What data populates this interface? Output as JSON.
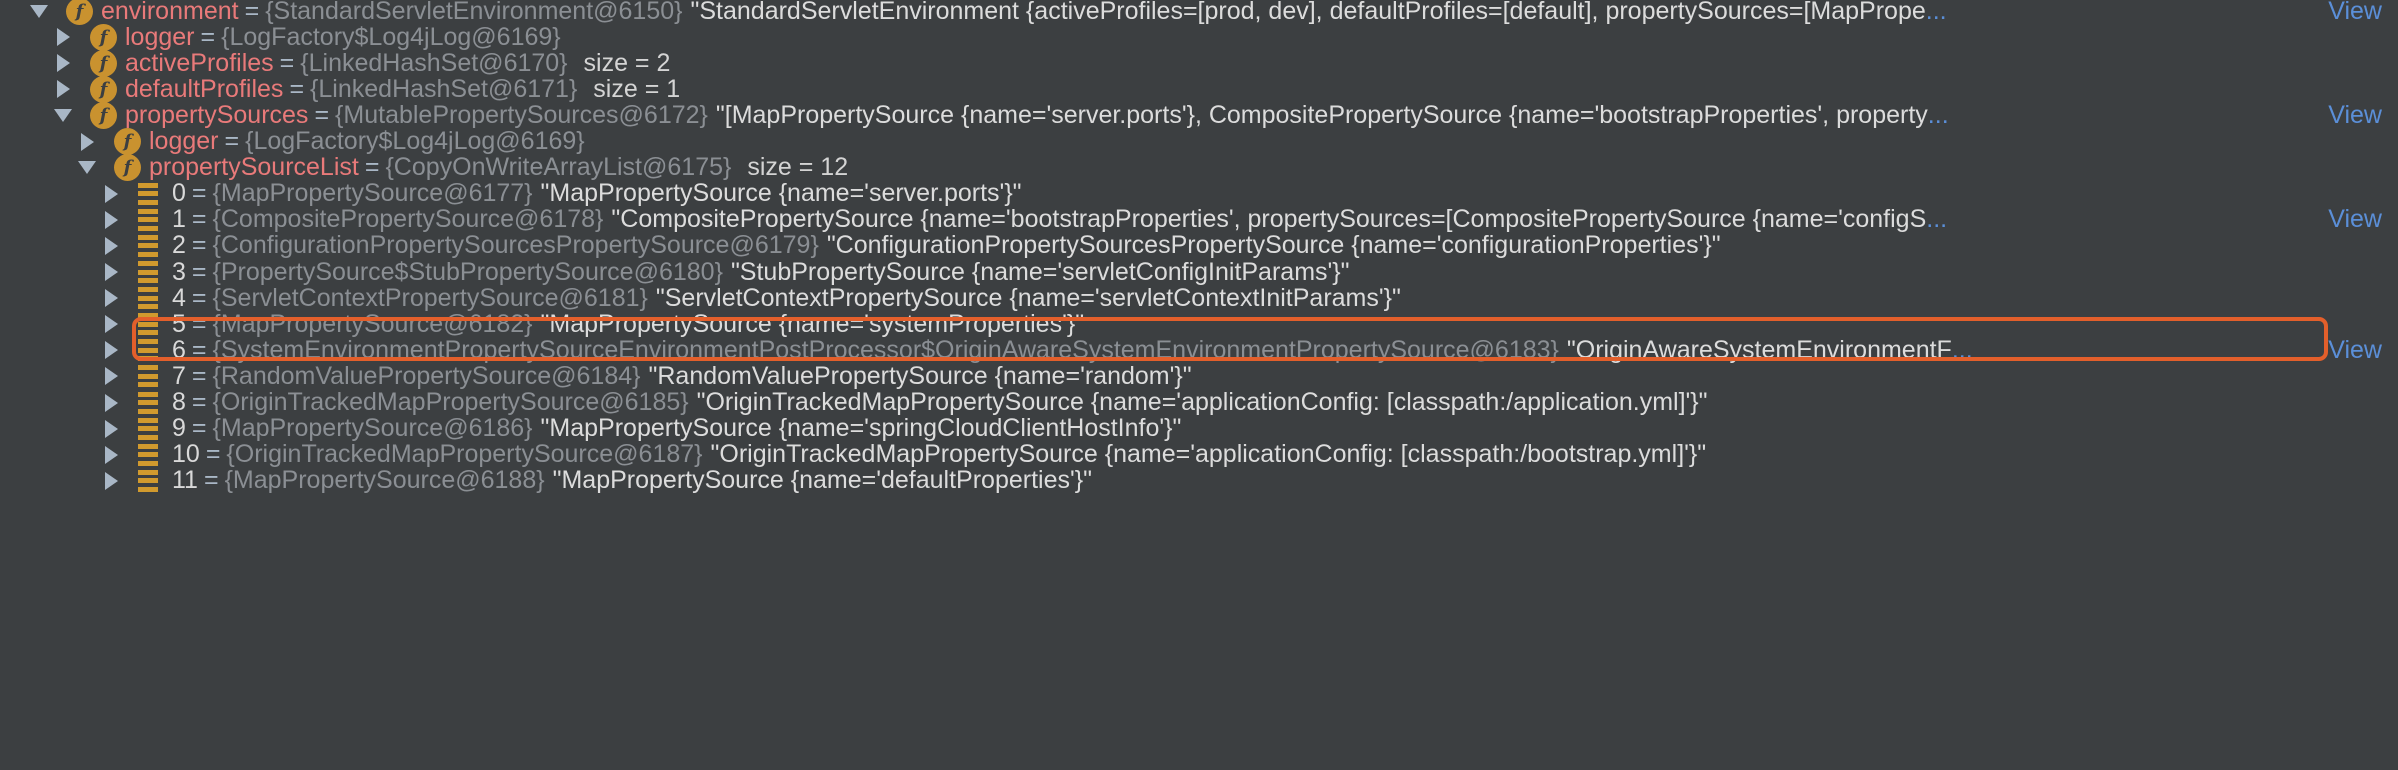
{
  "rows": [
    {
      "indent": 0,
      "expanded": true,
      "kind": "field",
      "name": "environment",
      "type": "{StandardServletEnvironment@6150}",
      "value": "\"StandardServletEnvironment {activeProfiles=[prod, dev], defaultProfiles=[default], propertySources=[MapPrope",
      "ellipsis": "...",
      "view": "View"
    },
    {
      "indent": 1,
      "expanded": false,
      "kind": "field",
      "name": "logger",
      "type": "{LogFactory$Log4jLog@6169}"
    },
    {
      "indent": 1,
      "expanded": false,
      "kind": "field",
      "name": "activeProfiles",
      "type": "{LinkedHashSet@6170}",
      "size": "size = 2"
    },
    {
      "indent": 1,
      "expanded": false,
      "kind": "field",
      "name": "defaultProfiles",
      "type": "{LinkedHashSet@6171}",
      "size": "size = 1"
    },
    {
      "indent": 1,
      "expanded": true,
      "kind": "field",
      "name": "propertySources",
      "type": "{MutablePropertySources@6172}",
      "value": "\"[MapPropertySource {name='server.ports'}, CompositePropertySource {name='bootstrapProperties', property",
      "ellipsis": "...",
      "view": "View"
    },
    {
      "indent": 2,
      "expanded": false,
      "kind": "field",
      "name": "logger",
      "type": "{LogFactory$Log4jLog@6169}"
    },
    {
      "indent": 2,
      "expanded": true,
      "kind": "field",
      "name": "propertySourceList",
      "type": "{CopyOnWriteArrayList@6175}",
      "size": "size = 12"
    },
    {
      "indent": 3,
      "expanded": false,
      "kind": "elem",
      "name": "0",
      "type": "{MapPropertySource@6177}",
      "value": "\"MapPropertySource {name='server.ports'}\""
    },
    {
      "indent": 3,
      "expanded": false,
      "kind": "elem",
      "name": "1",
      "type": "{CompositePropertySource@6178}",
      "value": "\"CompositePropertySource {name='bootstrapProperties', propertySources=[CompositePropertySource {name='configS",
      "ellipsis": "...",
      "view": "View"
    },
    {
      "indent": 3,
      "expanded": false,
      "kind": "elem",
      "name": "2",
      "type": "{ConfigurationPropertySourcesPropertySource@6179}",
      "value": "\"ConfigurationPropertySourcesPropertySource {name='configurationProperties'}\""
    },
    {
      "indent": 3,
      "expanded": false,
      "kind": "elem",
      "name": "3",
      "type": "{PropertySource$StubPropertySource@6180}",
      "value": "\"StubPropertySource {name='servletConfigInitParams'}\""
    },
    {
      "indent": 3,
      "expanded": false,
      "kind": "elem",
      "name": "4",
      "type": "{ServletContextPropertySource@6181}",
      "value": "\"ServletContextPropertySource {name='servletContextInitParams'}\""
    },
    {
      "indent": 3,
      "expanded": false,
      "kind": "elem",
      "name": "5",
      "type": "{MapPropertySource@6182}",
      "value": "\"MapPropertySource {name='systemProperties'}\""
    },
    {
      "indent": 3,
      "expanded": false,
      "kind": "elem",
      "name": "6",
      "type": "{SystemEnvironmentPropertySourceEnvironmentPostProcessor$OriginAwareSystemEnvironmentPropertySource@6183}",
      "value": "\"OriginAwareSystemEnvironmentF",
      "ellipsis": "...",
      "view": "View"
    },
    {
      "indent": 3,
      "expanded": false,
      "kind": "elem",
      "name": "7",
      "type": "{RandomValuePropertySource@6184}",
      "value": "\"RandomValuePropertySource {name='random'}\""
    },
    {
      "indent": 3,
      "expanded": false,
      "kind": "elem",
      "name": "8",
      "type": "{OriginTrackedMapPropertySource@6185}",
      "value": "\"OriginTrackedMapPropertySource {name='applicationConfig: [classpath:/application.yml]'}\""
    },
    {
      "indent": 3,
      "expanded": false,
      "kind": "elem",
      "name": "9",
      "type": "{MapPropertySource@6186}",
      "value": "\"MapPropertySource {name='springCloudClientHostInfo'}\""
    },
    {
      "indent": 3,
      "expanded": false,
      "kind": "elem",
      "name": "10",
      "type": "{OriginTrackedMapPropertySource@6187}",
      "value": "\"OriginTrackedMapPropertySource {name='applicationConfig: [classpath:/bootstrap.yml]'}\""
    },
    {
      "indent": 3,
      "expanded": false,
      "kind": "elem",
      "name": "11",
      "type": "{MapPropertySource@6188}",
      "value": "\"MapPropertySource {name='defaultProperties'}\""
    }
  ],
  "highlighted_row": "1",
  "colors": {
    "background": "#3c3f41",
    "field_name": "#e97a7a",
    "type": "#8b8f94",
    "link": "#5b8fd8",
    "highlight": "#e35f2b",
    "icon": "#c9922f"
  },
  "icons": {
    "field": "field-f-icon",
    "element": "array-element-icon",
    "expanded": "chevron-down-icon",
    "collapsed": "chevron-right-icon"
  }
}
